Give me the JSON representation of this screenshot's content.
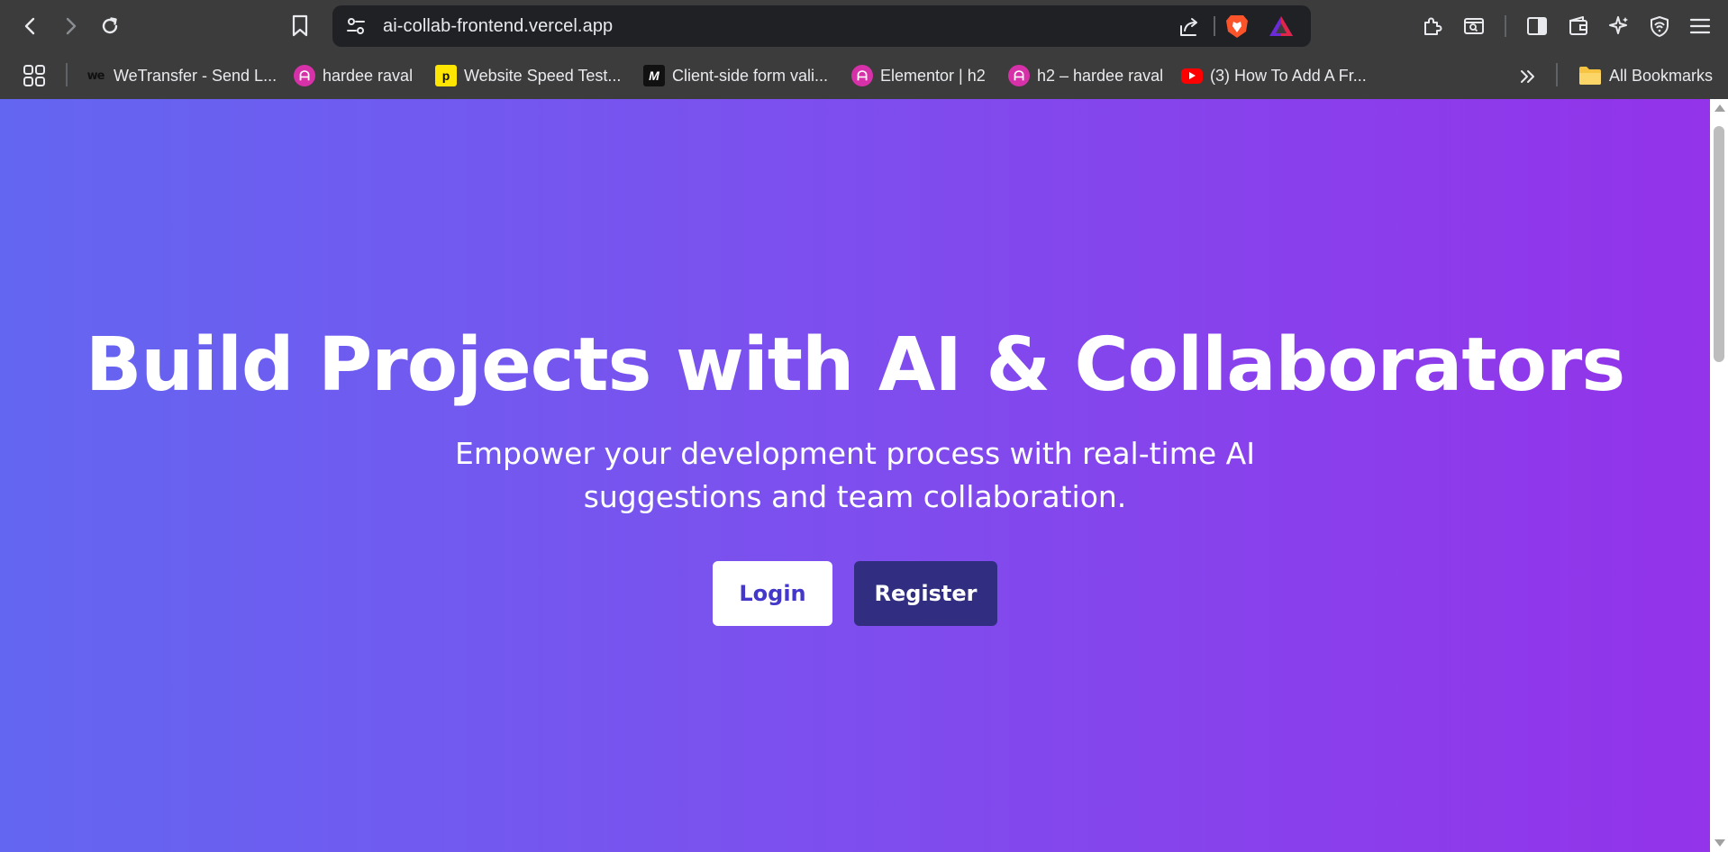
{
  "browser": {
    "url": "ai-collab-frontend.vercel.app",
    "bookmarks": [
      {
        "label": "WeTransfer - Send L...",
        "icon": "wetransfer-icon"
      },
      {
        "label": "hardee raval",
        "icon": "hardee-icon"
      },
      {
        "label": "Website Speed Test...",
        "icon": "pingdom-icon"
      },
      {
        "label": "Client-side form vali...",
        "icon": "mdn-icon"
      },
      {
        "label": "Elementor | h2",
        "icon": "hardee-icon"
      },
      {
        "label": "h2 – hardee raval",
        "icon": "hardee-icon"
      },
      {
        "label": "(3) How To Add A Fr...",
        "icon": "youtube-icon"
      }
    ],
    "all_bookmarks_label": "All Bookmarks",
    "favicon_letters": {
      "we": "we",
      "h": "ᗩ",
      "p": "p",
      "m": "M"
    }
  },
  "hero": {
    "title": "Build Projects with AI & Collaborators",
    "subtitle": "Empower your development process with real-time AI suggestions and team collaboration.",
    "login_label": "Login",
    "register_label": "Register"
  },
  "colors": {
    "gradient_start": "#6366f1",
    "gradient_end": "#9333ea",
    "login_text": "#4338ca",
    "register_bg": "#312e81"
  }
}
